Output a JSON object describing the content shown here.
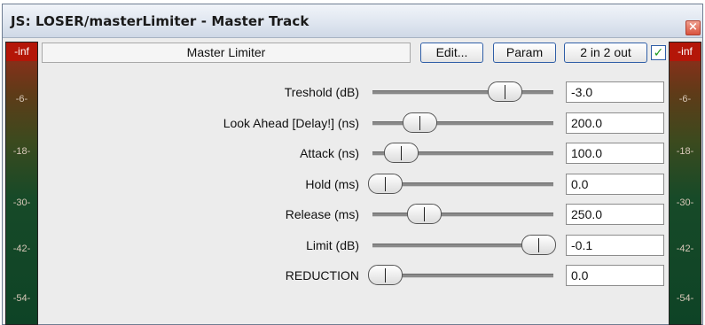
{
  "window": {
    "title": "JS: LOSER/masterLimiter - Master Track",
    "close_glyph": "×"
  },
  "header": {
    "plugin_name": "Master Limiter",
    "edit_label": "Edit...",
    "param_label": "Param",
    "io_label": "2 in 2 out",
    "enabled": true,
    "check_glyph": "✓"
  },
  "meters": {
    "cap": "-inf",
    "ticks": [
      "-6-",
      "-18-",
      "-30-",
      "-42-",
      "-54-"
    ]
  },
  "params": [
    {
      "label": "Treshold (dB)",
      "value": "-3.0",
      "slider": 0.77
    },
    {
      "label": "Look Ahead [Delay!] (ns)",
      "value": "200.0",
      "slider": 0.22
    },
    {
      "label": "Attack (ns)",
      "value": "100.0",
      "slider": 0.1
    },
    {
      "label": "Hold (ms)",
      "value": "0.0",
      "slider": 0.0
    },
    {
      "label": "Release (ms)",
      "value": "250.0",
      "slider": 0.25
    },
    {
      "label": "Limit (dB)",
      "value": "-0.1",
      "slider": 0.99
    },
    {
      "label": "REDUCTION",
      "value": "0.0",
      "slider": 0.0
    }
  ],
  "colors": {
    "accent": "#2f5ea7",
    "meter_cap": "#b41608",
    "close": "#d9533e"
  }
}
